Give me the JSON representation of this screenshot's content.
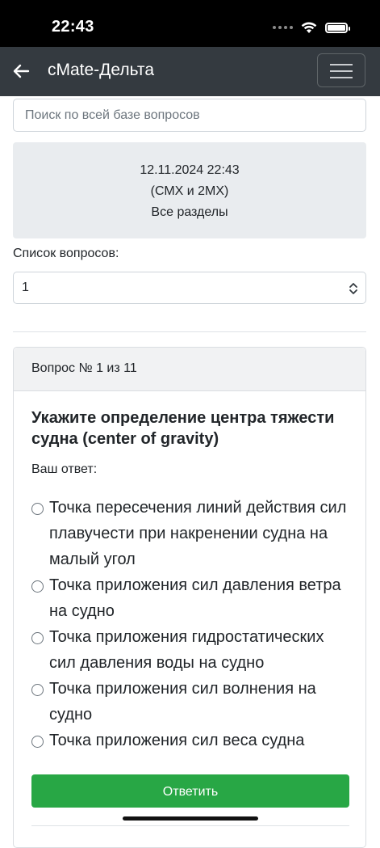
{
  "status_bar": {
    "time": "22:43"
  },
  "navbar": {
    "back_icon": "arrow-left-icon",
    "title": "cMate-Дельта",
    "menu_icon": "hamburger-menu-icon"
  },
  "search": {
    "placeholder": "Поиск по всей базе вопросов",
    "value": ""
  },
  "info": {
    "datetime": "12.11.2024 22:43",
    "category": "(СМХ и 2МХ)",
    "sections": "Все разделы"
  },
  "question_list": {
    "label": "Список вопросов:",
    "selected": "1"
  },
  "question": {
    "header": "Вопрос № 1 из 11",
    "title": "Укажите определение центра тяжести судна (center of gravity)",
    "answer_label": "Ваш ответ:",
    "options": [
      {
        "text": "Точка пересечения линий действия сил плавучести при накренении судна на малый угол"
      },
      {
        "text": "Точка приложения сил давления ветра на судно"
      },
      {
        "text": "Точка приложения гидростатических сил давления воды на судно"
      },
      {
        "text": "Точка приложения сил волнения на судно"
      },
      {
        "text": "Точка приложения сил веса судна"
      }
    ],
    "submit_label": "Ответить"
  },
  "colors": {
    "navbar_bg": "#343a40",
    "submit_bg": "#28a745",
    "info_bg": "#e9ecef"
  }
}
